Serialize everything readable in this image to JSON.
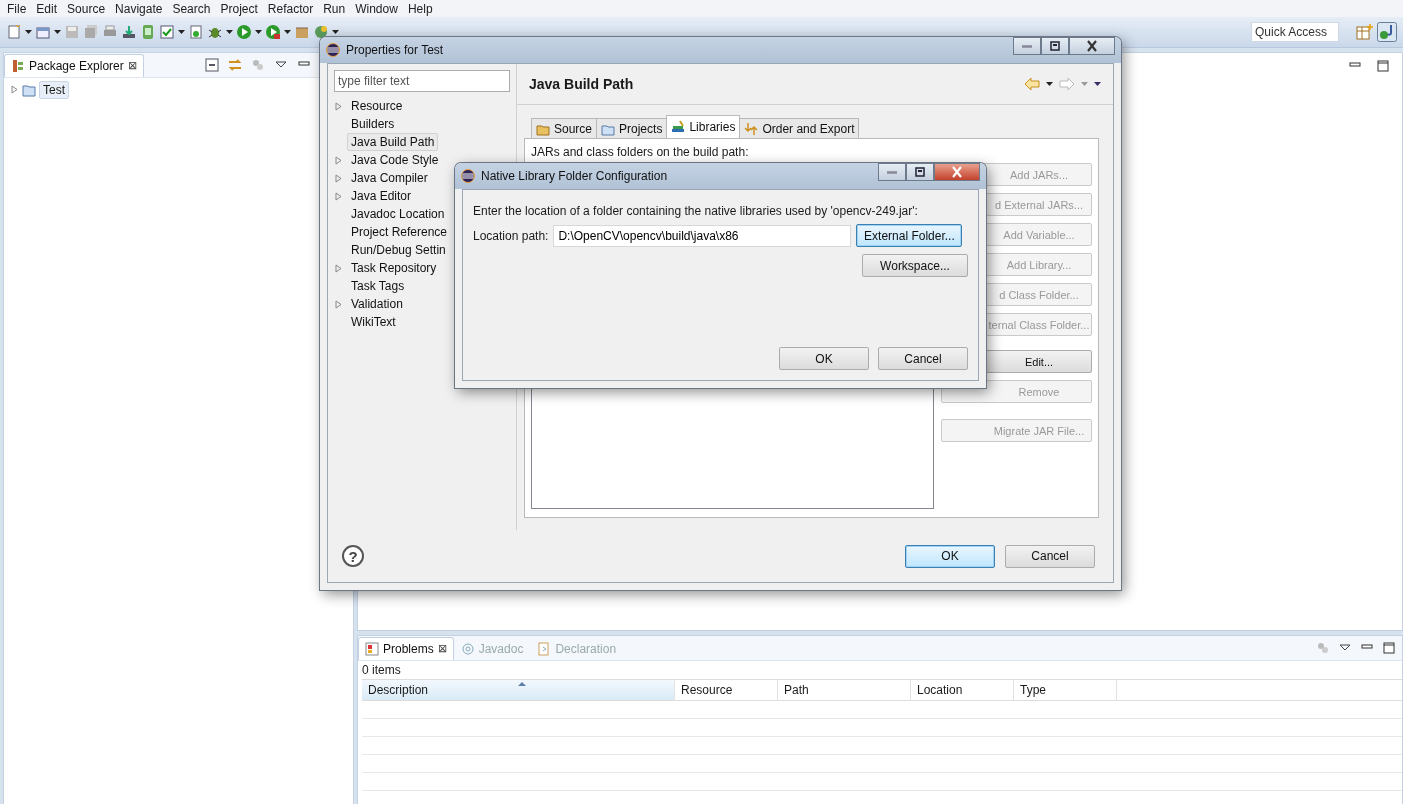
{
  "menu": [
    "File",
    "Edit",
    "Source",
    "Navigate",
    "Search",
    "Project",
    "Refactor",
    "Run",
    "Window",
    "Help"
  ],
  "quick_access": {
    "placeholder": "Quick Access"
  },
  "package_explorer": {
    "title": "Package Explorer",
    "close": "⊠",
    "tree": [
      {
        "label": "Test",
        "expanded": false,
        "selected": true
      }
    ]
  },
  "properties_dialog": {
    "title": "Properties for Test",
    "filter": {
      "placeholder": "type filter text"
    },
    "nav": [
      {
        "label": "Resource",
        "expandable": true,
        "selected": false
      },
      {
        "label": "Builders",
        "expandable": false,
        "selected": false
      },
      {
        "label": "Java Build Path",
        "expandable": false,
        "selected": true
      },
      {
        "label": "Java Code Style",
        "expandable": true,
        "selected": false
      },
      {
        "label": "Java Compiler",
        "expandable": true,
        "selected": false
      },
      {
        "label": "Java Editor",
        "expandable": true,
        "selected": false
      },
      {
        "label": "Javadoc Location",
        "expandable": false,
        "selected": false
      },
      {
        "label": "Project Reference",
        "expandable": false,
        "selected": false
      },
      {
        "label": "Run/Debug Settin",
        "expandable": false,
        "selected": false
      },
      {
        "label": "Task Repository",
        "expandable": true,
        "selected": false
      },
      {
        "label": "Task Tags",
        "expandable": false,
        "selected": false
      },
      {
        "label": "Validation",
        "expandable": true,
        "selected": false
      },
      {
        "label": "WikiText",
        "expandable": false,
        "selected": false
      }
    ],
    "page_title": "Java Build Path",
    "tabs": [
      {
        "label": "Source",
        "kind": "source",
        "selected": false
      },
      {
        "label": "Projects",
        "kind": "projects",
        "selected": false
      },
      {
        "label": "Libraries",
        "kind": "libraries",
        "selected": true
      },
      {
        "label": "Order and Export",
        "kind": "order",
        "selected": false
      }
    ],
    "list_label": "JARs and class folders on the build path:",
    "side_buttons": [
      {
        "label": "Add JARs...",
        "disabled": true
      },
      {
        "label": "d External JARs...",
        "disabled": true
      },
      {
        "label": "Add Variable...",
        "disabled": true
      },
      {
        "label": "Add Library...",
        "disabled": true
      },
      {
        "label": "d Class Folder...",
        "disabled": true
      },
      {
        "label": "ternal Class Folder...",
        "disabled": true
      },
      {
        "label": "Edit...",
        "disabled": false
      },
      {
        "label": "Remove",
        "disabled": true
      },
      {
        "label": "Migrate JAR File...",
        "disabled": true
      }
    ],
    "help": "?",
    "buttons": [
      {
        "label": "OK",
        "default": true
      },
      {
        "label": "Cancel",
        "default": false
      }
    ]
  },
  "native_dialog": {
    "title": "Native Library Folder Configuration",
    "message": "Enter the location of a folder containing the native libraries used by 'opencv-249.jar':",
    "field_label": "Location path:",
    "value": "D:\\OpenCV\\opencv\\build\\java\\x86",
    "side_buttons": [
      {
        "label": "External Folder...",
        "default": true
      },
      {
        "label": "Workspace...",
        "default": false
      }
    ],
    "buttons": [
      {
        "label": "OK",
        "default": false
      },
      {
        "label": "Cancel",
        "default": false
      }
    ]
  },
  "problems_view": {
    "tabs": [
      {
        "label": "Problems",
        "selected": true
      },
      {
        "label": "Javadoc",
        "selected": false
      },
      {
        "label": "Declaration",
        "selected": false
      }
    ],
    "close": "⊠",
    "count": "0 items",
    "columns": [
      {
        "label": "Description",
        "sorted": true
      },
      {
        "label": "Resource",
        "sorted": false
      },
      {
        "label": "Path",
        "sorted": false
      },
      {
        "label": "Location",
        "sorted": false
      },
      {
        "label": "Type",
        "sorted": false
      }
    ]
  }
}
